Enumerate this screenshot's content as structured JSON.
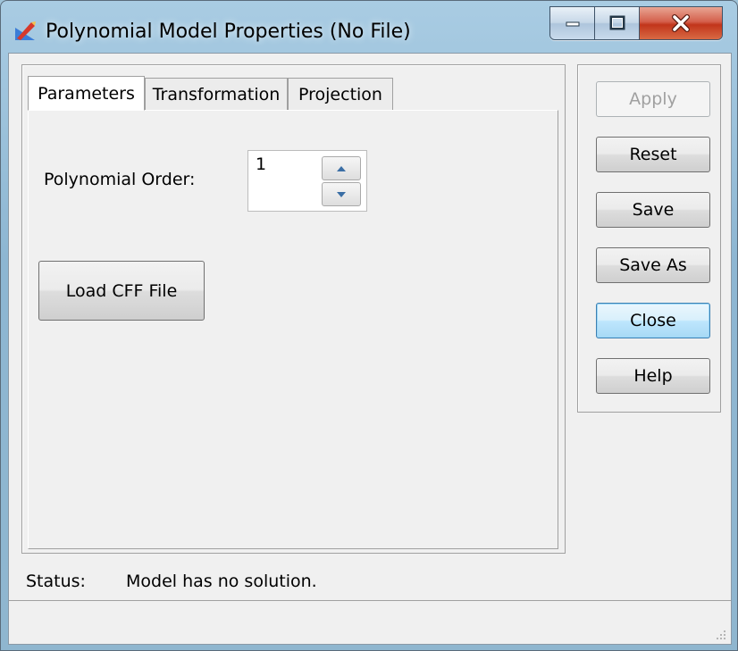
{
  "window": {
    "title": "Polynomial Model Properties (No File)",
    "icons": {
      "app": "model-properties-icon",
      "minimize": "minimize-icon",
      "maximize": "maximize-icon",
      "close": "close-icon"
    }
  },
  "tabs": [
    {
      "label": "Parameters",
      "active": true
    },
    {
      "label": "Transformation",
      "active": false
    },
    {
      "label": "Projection",
      "active": false
    }
  ],
  "parameters": {
    "polynomial_order_label": "Polynomial Order:",
    "polynomial_order_value": "1",
    "load_button": "Load CFF File"
  },
  "actions": {
    "apply": "Apply",
    "reset": "Reset",
    "save": "Save",
    "save_as": "Save As",
    "close": "Close",
    "help": "Help"
  },
  "status": {
    "label": "Status:",
    "message": "Model has no solution."
  },
  "colors": {
    "default_button": "#bee6fd",
    "close_caption": "#c2351b"
  }
}
